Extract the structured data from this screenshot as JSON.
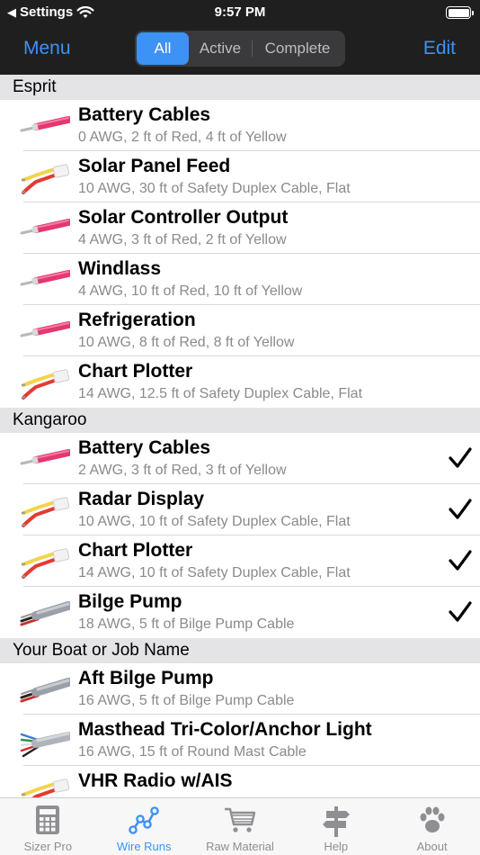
{
  "status_bar": {
    "back_app": "Settings",
    "time": "9:57 PM"
  },
  "nav": {
    "menu_label": "Menu",
    "edit_label": "Edit",
    "segments": [
      "All",
      "Active",
      "Complete"
    ],
    "selected_segment": "All",
    "accent_color": "#3d92f5"
  },
  "sections": [
    {
      "name": "Esprit",
      "items": [
        {
          "title": "Battery Cables",
          "detail": "0 AWG, 2 ft of Red, 4 ft of Yellow",
          "icon": "battery-cable-icon",
          "complete": false
        },
        {
          "title": "Solar Panel Feed",
          "detail": "10 AWG, 30 ft of Safety Duplex Cable, Flat",
          "icon": "duplex-cable-icon",
          "complete": false
        },
        {
          "title": "Solar Controller Output",
          "detail": "4 AWG, 3 ft of Red, 2 ft of Yellow",
          "icon": "battery-cable-icon",
          "complete": false
        },
        {
          "title": "Windlass",
          "detail": "4 AWG, 10 ft of Red, 10 ft of Yellow",
          "icon": "battery-cable-icon",
          "complete": false
        },
        {
          "title": "Refrigeration",
          "detail": "10 AWG, 8 ft of Red, 8 ft of Yellow",
          "icon": "battery-cable-icon",
          "complete": false
        },
        {
          "title": "Chart Plotter",
          "detail": "14 AWG, 12.5 ft of Safety Duplex Cable, Flat",
          "icon": "duplex-cable-icon",
          "complete": false
        }
      ]
    },
    {
      "name": "Kangaroo",
      "items": [
        {
          "title": "Battery Cables",
          "detail": "2 AWG, 3 ft of Red, 3 ft of Yellow",
          "icon": "battery-cable-icon",
          "complete": true
        },
        {
          "title": "Radar Display",
          "detail": "10 AWG, 10 ft of Safety Duplex Cable, Flat",
          "icon": "duplex-cable-icon",
          "complete": true
        },
        {
          "title": "Chart Plotter",
          "detail": "14 AWG, 10 ft of Safety Duplex Cable, Flat",
          "icon": "duplex-cable-icon",
          "complete": true
        },
        {
          "title": "Bilge Pump",
          "detail": "18 AWG, 5 ft of Bilge Pump Cable",
          "icon": "bilge-pump-cable-icon",
          "complete": true
        }
      ]
    },
    {
      "name": "Your Boat or Job Name",
      "items": [
        {
          "title": "Aft Bilge Pump",
          "detail": "16 AWG, 5 ft of Bilge Pump Cable",
          "icon": "bilge-pump-cable-icon",
          "complete": false
        },
        {
          "title": "Masthead Tri-Color/Anchor Light",
          "detail": "16 AWG, 15 ft of Round Mast Cable",
          "icon": "mast-cable-icon",
          "complete": false
        },
        {
          "title": "VHR Radio w/AIS",
          "detail": "",
          "icon": "duplex-cable-icon",
          "complete": false
        }
      ]
    }
  ],
  "tabs": [
    {
      "label": "Sizer Pro",
      "icon": "calculator-icon",
      "selected": false
    },
    {
      "label": "Wire Runs",
      "icon": "wire-runs-icon",
      "selected": true
    },
    {
      "label": "Raw Material",
      "icon": "cart-icon",
      "selected": false
    },
    {
      "label": "Help",
      "icon": "signpost-icon",
      "selected": false
    },
    {
      "label": "About",
      "icon": "paw-icon",
      "selected": false
    }
  ]
}
